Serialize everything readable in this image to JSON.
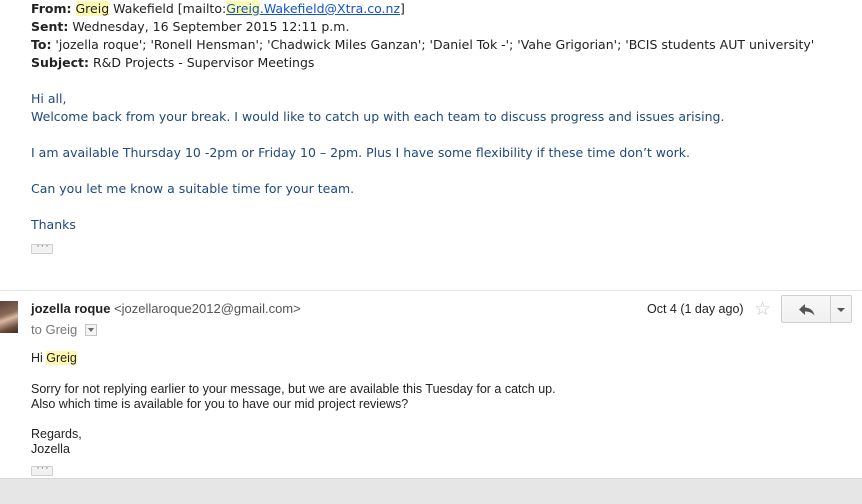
{
  "quoted_header": {
    "from_label": "From:",
    "from_first": "Greig",
    "from_last": " Wakefield [mailto:",
    "from_link_hl": "Greig",
    "from_link_rest": ".Wakefield@Xtra.co.nz",
    "from_close": "]",
    "sent_label": "Sent:",
    "sent_value": " Wednesday, 16 September 2015 12:11 p.m.",
    "to_label": "To:",
    "to_value": " 'jozella roque'; 'Ronell Hensman'; 'Chadwick Miles Ganzan'; 'Daniel Tok -'; 'Vahe Grigorian'; 'BCIS students AUT university'",
    "subject_label": "Subject:",
    "subject_value": " R&D Projects - Supervisor Meetings"
  },
  "quoted_body": {
    "line1": "Hi all,",
    "line2": "Welcome back from your break. I would like to catch up with each team to discuss progress and issues arising.",
    "line3": "I am available Thursday 10 -2pm or Friday 10 – 2pm. Plus I have some flexibility if these time don’t work.",
    "line4": "Can you let me know a suitable time for your team.",
    "line5": "Thanks"
  },
  "message": {
    "sender_name": "jozella roque",
    "sender_email": " <jozellaroque2012@gmail.com>",
    "to_text": "to Greig",
    "date": "Oct 4 (1 day ago)",
    "star_glyph": "☆",
    "greeting_hi": "Hi ",
    "greeting_name": "Greig",
    "body_line1": "Sorry for not replying earlier to your message, but we are available this Tuesday for a catch up.",
    "body_line2": "Also which time is available for you to have our mid project reviews?",
    "signoff": "Regards,",
    "signature": "Jozella",
    "ellipsis": "···"
  },
  "colors": {
    "quoted_body_text": "#1f497d",
    "highlight": "#fff9b0",
    "link": "#1155cc"
  }
}
